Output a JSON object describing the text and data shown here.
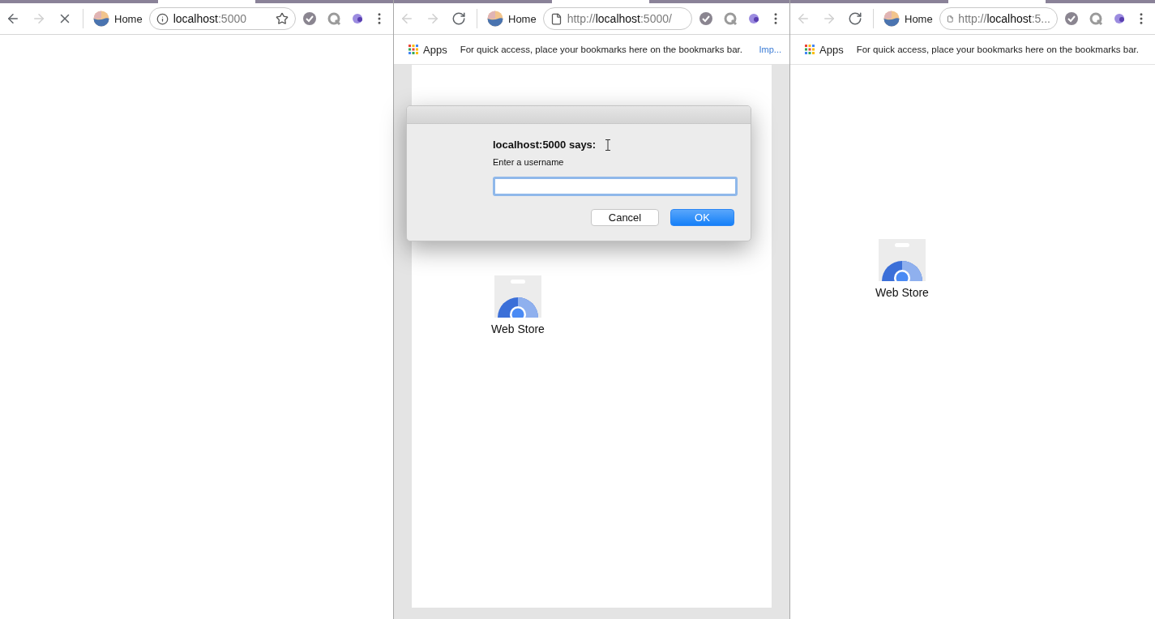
{
  "windows": [
    {
      "nav": [
        {
          "kind": "back",
          "disabled": false
        },
        {
          "kind": "forward",
          "disabled": true
        },
        {
          "kind": "stop",
          "disabled": false
        }
      ],
      "home_label": "Home",
      "url": {
        "kind": "info",
        "parts": [
          {
            "text": "localhost",
            "dim": false
          },
          {
            "text": ":5000",
            "dim": true
          }
        ]
      },
      "bookmark_star": true,
      "extensions": [
        {
          "kind": "check"
        },
        {
          "kind": "q"
        },
        {
          "kind": "moon"
        }
      ]
    },
    {
      "nav": [
        {
          "kind": "back",
          "disabled": true
        },
        {
          "kind": "forward",
          "disabled": true
        },
        {
          "kind": "reload",
          "disabled": false
        }
      ],
      "home_label": "Home",
      "url": {
        "kind": "page",
        "parts": [
          {
            "text": "http://",
            "dim": true
          },
          {
            "text": "localhost",
            "dim": false
          },
          {
            "text": ":5000/",
            "dim": true
          }
        ]
      },
      "bookmark_star": false,
      "extensions": [
        {
          "kind": "check"
        },
        {
          "kind": "q"
        },
        {
          "kind": "moon"
        }
      ],
      "bookmarks_bar": {
        "apps_label": "Apps",
        "hint": "For quick access, place your bookmarks here on the bookmarks bar.",
        "import_link": "Imp..."
      },
      "dialog": {
        "title": "localhost:5000 says:",
        "message": "Enter a username",
        "buttons": [
          {
            "label": "Cancel",
            "primary": false
          },
          {
            "label": "OK",
            "primary": true
          }
        ]
      },
      "apps": [
        {
          "label": "Web Store"
        }
      ]
    },
    {
      "nav": [
        {
          "kind": "back",
          "disabled": true
        },
        {
          "kind": "forward",
          "disabled": true
        },
        {
          "kind": "reload",
          "disabled": false
        }
      ],
      "home_label": "Home",
      "url": {
        "kind": "page",
        "parts": [
          {
            "text": "http://",
            "dim": true
          },
          {
            "text": "localhost",
            "dim": false
          },
          {
            "text": ":5...",
            "dim": true
          }
        ]
      },
      "bookmark_star": false,
      "extensions": [
        {
          "kind": "check"
        },
        {
          "kind": "q"
        },
        {
          "kind": "moon"
        }
      ],
      "bookmarks_bar": {
        "apps_label": "Apps",
        "hint": "For quick access, place your bookmarks here on the bookmarks bar."
      },
      "apps": [
        {
          "label": "Web Store"
        }
      ]
    }
  ]
}
